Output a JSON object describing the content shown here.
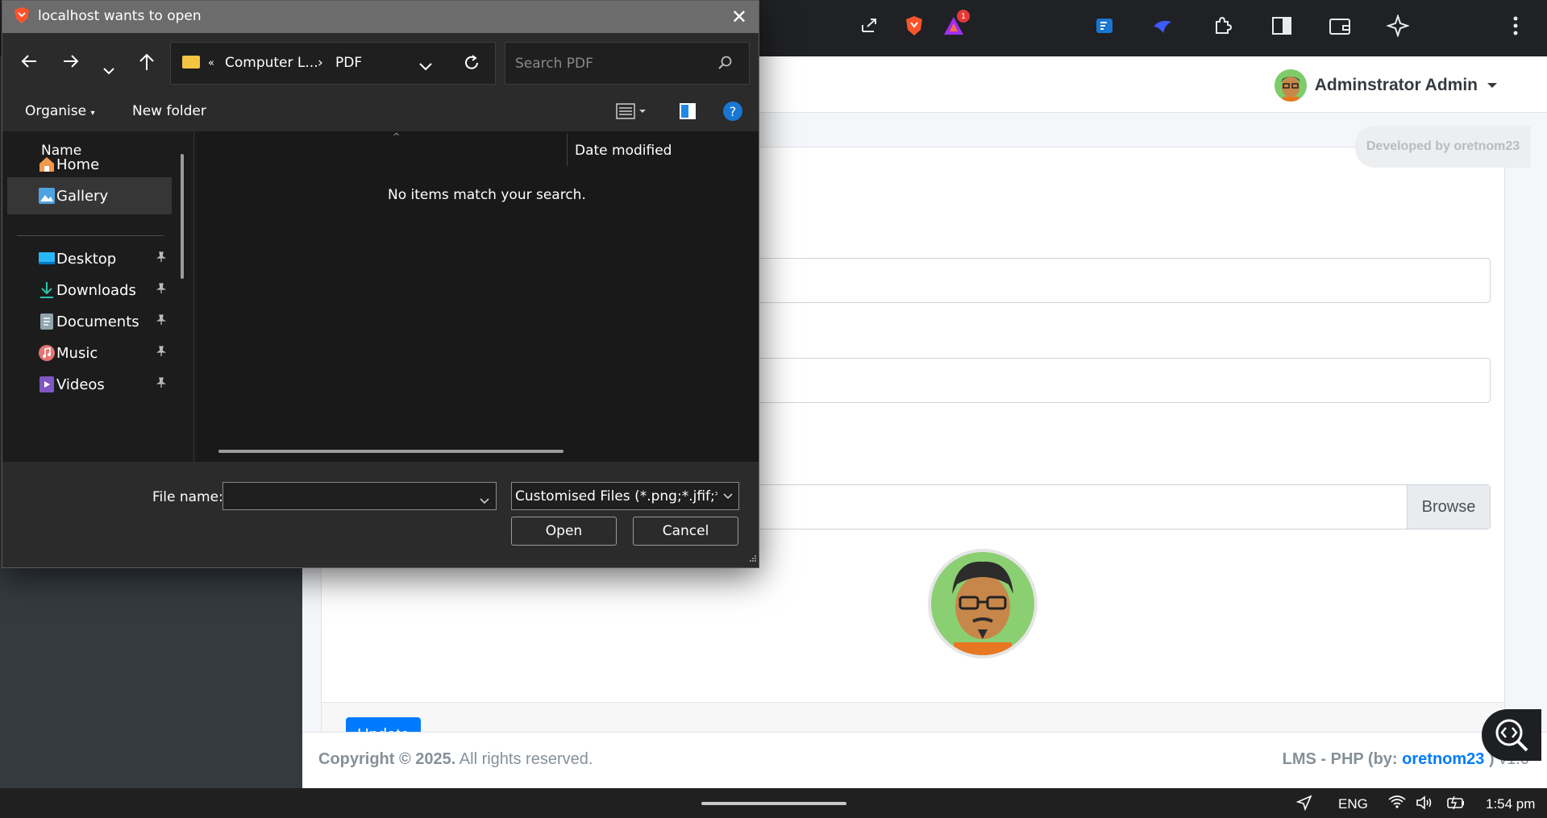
{
  "dialog": {
    "title": "localhost wants to open",
    "address": {
      "overflow": "«",
      "crumb1": "Computer L...",
      "separator": "›",
      "crumb2": "PDF"
    },
    "search_placeholder": "Search PDF",
    "toolbar": {
      "organise": "Organise",
      "new_folder": "New folder"
    },
    "nav_items": [
      {
        "label": "Home",
        "icon": "home-icon",
        "pinned": false
      },
      {
        "label": "Gallery",
        "icon": "gallery-icon",
        "pinned": false,
        "selected": true
      },
      {
        "label": "Desktop",
        "icon": "desktop-icon",
        "pinned": true
      },
      {
        "label": "Downloads",
        "icon": "download-icon",
        "pinned": true
      },
      {
        "label": "Documents",
        "icon": "documents-icon",
        "pinned": true
      },
      {
        "label": "Music",
        "icon": "music-icon",
        "pinned": true
      },
      {
        "label": "Videos",
        "icon": "videos-icon",
        "pinned": true
      }
    ],
    "columns": {
      "name": "Name",
      "date_modified": "Date modified"
    },
    "empty_message": "No items match your search.",
    "file_name_label": "File name:",
    "file_name_value": "",
    "filter": "Customised Files (*.png;*.jfif;*.p",
    "open_label": "Open",
    "cancel_label": "Cancel"
  },
  "page": {
    "user_name": "Adminstrator Admin",
    "dev_badge": "Developed by oretnom23",
    "browse_label": "Browse",
    "update_label": "Update",
    "footer": {
      "copyright_bold": "Copyright © 2025.",
      "copyright_rest": " All rights reserved.",
      "app_prefix": "LMS - PHP (by: ",
      "author": "oretnom23",
      "app_suffix": " ) ",
      "version": "v1.0"
    }
  },
  "browser": {
    "notification_count": "1"
  },
  "taskbar": {
    "language": "ENG",
    "time": "1:54 pm"
  },
  "colors": {
    "primary": "#007bff",
    "dialog_bg": "#1c1c1c",
    "sidebar": "#343a40"
  }
}
